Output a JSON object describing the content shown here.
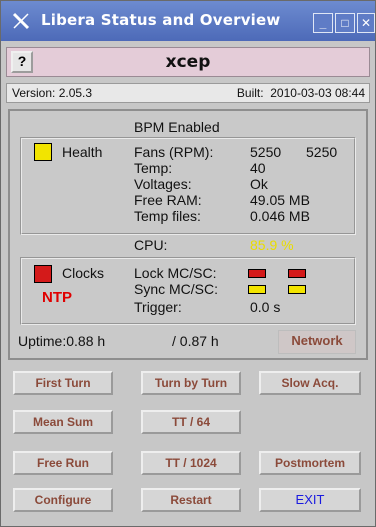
{
  "window": {
    "title": "Libera Status and Overview"
  },
  "header": {
    "help_label": "?",
    "device_name": "xcep"
  },
  "info": {
    "version": "Version: 2.05.3",
    "built_label": "Built:",
    "built_date": "2010-03-03 08:44"
  },
  "health": {
    "bpm_status": "BPM Enabled",
    "label": "Health",
    "status_color": "#f2e400",
    "fans_label": "Fans (RPM):",
    "fan1": "5250",
    "fan2": "5250",
    "temp_label": "Temp:",
    "temp_value": "40",
    "voltages_label": "Voltages:",
    "voltages_value": "Ok",
    "free_ram_label": "Free RAM:",
    "free_ram_value": "49.05 MB",
    "temp_files_label": "Temp files:",
    "temp_files_value": "0.046 MB",
    "cpu_label": "CPU:",
    "cpu_value": "85.9 %",
    "cpu_color": "#e9dd00"
  },
  "clocks": {
    "label": "Clocks",
    "status_color": "#d41a1a",
    "ntp_label": "NTP",
    "ntp_color": "#e00000",
    "lock_label": "Lock MC/SC:",
    "lock_colors": [
      "#d41a1a",
      "#d41a1a"
    ],
    "sync_label": "Sync MC/SC:",
    "sync_colors": [
      "#f2e400",
      "#f2e400"
    ],
    "trigger_label": "Trigger:",
    "trigger_value": "0.0 s"
  },
  "uptime": {
    "label": "Uptime:",
    "value1": "0.88 h",
    "value2": "/ 0.87 h"
  },
  "network_label": "Network",
  "buttons": {
    "first_turn": "First Turn",
    "turn_by_turn": "Turn by Turn",
    "slow_acq": "Slow Acq.",
    "mean_sum": "Mean Sum",
    "tt64": "TT / 64",
    "free_run": "Free Run",
    "tt1024": "TT / 1024",
    "postmortem": "Postmortem",
    "configure": "Configure",
    "restart": "Restart",
    "exit": "EXIT"
  },
  "colors": {
    "title_bar": "#5874bf",
    "button_text": "#8b4a3a",
    "exit_text": "#1a1ae0",
    "header_bg": "#e4ccd8"
  }
}
